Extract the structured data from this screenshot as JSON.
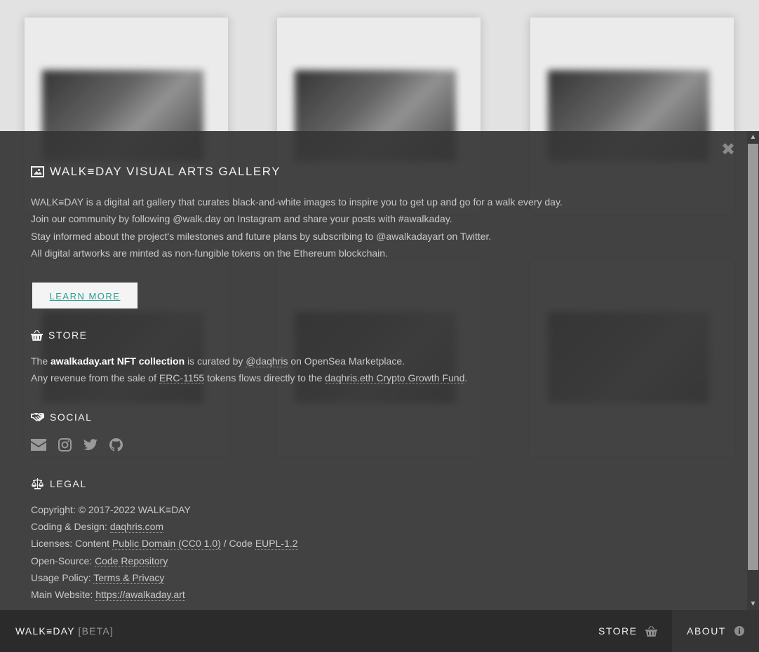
{
  "gallery": {
    "card_count": 6
  },
  "about": {
    "title": "WALK≡DAY VISUAL ARTS GALLERY",
    "intro": [
      "WALK≡DAY is a digital art gallery that curates black-and-white images to inspire you to get up and go for a walk every day.",
      "Join our community by following @walk.day on Instagram and share your posts with #awalkaday.",
      "Stay informed about the project's milestones and future plans by subscribing to @awalkadayart on Twitter.",
      "All digital artworks are minted as non-fungible tokens on the Ethereum blockchain."
    ],
    "learn_more_label": "LEARN MORE",
    "close_icon": "close-icon",
    "store": {
      "title": "STORE",
      "line1_prefix": "The ",
      "line1_collection": "awalkaday.art NFT collection",
      "line1_mid": " is curated by ",
      "line1_curator": "@daqhris",
      "line1_suffix": " on OpenSea Marketplace.",
      "line2_prefix": "Any revenue from the sale of ",
      "line2_token": "ERC-1155",
      "line2_mid": " tokens flows directly to the ",
      "line2_fund": "daqhris.eth Crypto Growth Fund",
      "line2_suffix": "."
    },
    "social": {
      "title": "SOCIAL",
      "icons": [
        "email-icon",
        "instagram-icon",
        "twitter-icon",
        "github-icon"
      ]
    },
    "legal": {
      "title": "LEGAL",
      "copyright": "Copyright: © 2017-2022 WALK≡DAY",
      "design_label": "Coding & Design: ",
      "design_link": "daqhris.com",
      "licenses_label": "Licenses: Content ",
      "licenses_content": "Public Domain (CC0 1.0)",
      "licenses_mid": " / Code ",
      "licenses_code": "EUPL-1.2",
      "opensource_label": "Open-Source: ",
      "opensource_link": "Code Repository",
      "usage_label": "Usage Policy: ",
      "usage_link": "Terms & Privacy",
      "website_label": "Main Website: ",
      "website_link": "https://awalkaday.art"
    }
  },
  "bottombar": {
    "brand": "WALK≡DAY",
    "beta": "[BETA]",
    "store_label": "STORE",
    "about_label": "ABOUT"
  }
}
